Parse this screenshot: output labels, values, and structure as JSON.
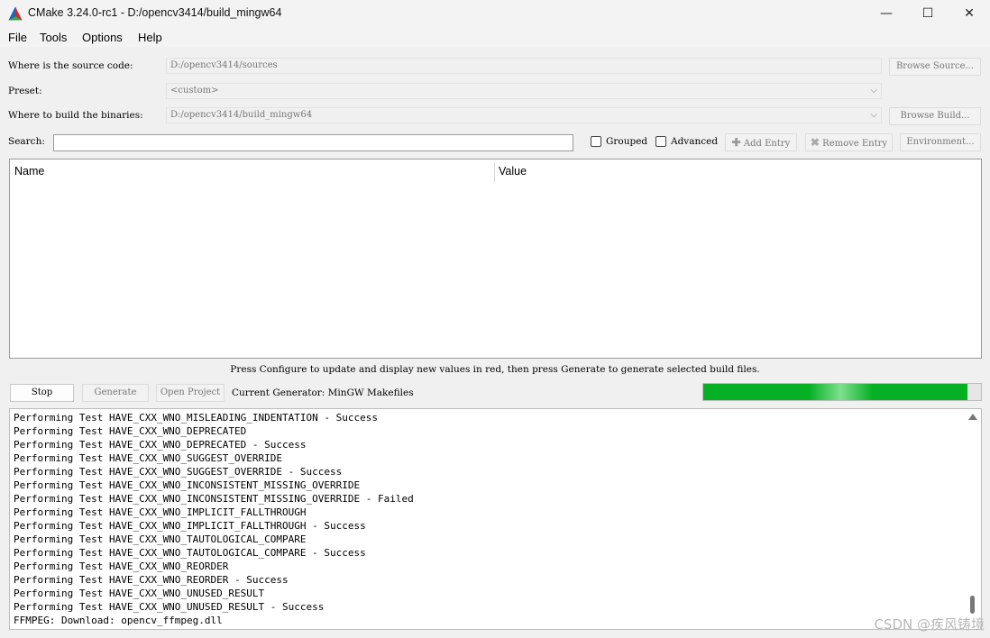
{
  "window": {
    "title": "CMake 3.24.0-rc1 - D:/opencv3414/build_mingw64",
    "controls": {
      "minimize": "—",
      "maximize": "☐",
      "close": "✕"
    }
  },
  "menu": [
    "File",
    "Tools",
    "Options",
    "Help"
  ],
  "form": {
    "source_label": "Where is the source code:",
    "source_value": "D:/opencv3414/sources",
    "browse_source": "Browse Source...",
    "preset_label": "Preset:",
    "preset_value": "<custom>",
    "build_label": "Where to build the binaries:",
    "build_value": "D:/opencv3414/build_mingw64",
    "browse_build": "Browse Build...",
    "search_label": "Search:",
    "search_value": "",
    "grouped_label": "Grouped",
    "grouped_checked": false,
    "advanced_label": "Advanced",
    "advanced_checked": false,
    "add_entry": "Add Entry",
    "remove_entry": "Remove Entry",
    "environment": "Environment..."
  },
  "table": {
    "columns": [
      "Name",
      "Value"
    ],
    "rows": []
  },
  "hint": "Press Configure to update and display new values in red, then press Generate to generate selected build files.",
  "actions": {
    "stop": "Stop",
    "generate": "Generate",
    "open_project": "Open Project",
    "generator_text": "Current Generator: MinGW Makefiles"
  },
  "progress": {
    "value_fraction": 0.95,
    "color": "#06b025"
  },
  "log": [
    "Performing Test HAVE_CXX_WNO_MISLEADING_INDENTATION - Success",
    "Performing Test HAVE_CXX_WNO_DEPRECATED",
    "Performing Test HAVE_CXX_WNO_DEPRECATED - Success",
    "Performing Test HAVE_CXX_WNO_SUGGEST_OVERRIDE",
    "Performing Test HAVE_CXX_WNO_SUGGEST_OVERRIDE - Success",
    "Performing Test HAVE_CXX_WNO_INCONSISTENT_MISSING_OVERRIDE",
    "Performing Test HAVE_CXX_WNO_INCONSISTENT_MISSING_OVERRIDE - Failed",
    "Performing Test HAVE_CXX_WNO_IMPLICIT_FALLTHROUGH",
    "Performing Test HAVE_CXX_WNO_IMPLICIT_FALLTHROUGH - Success",
    "Performing Test HAVE_CXX_WNO_TAUTOLOGICAL_COMPARE",
    "Performing Test HAVE_CXX_WNO_TAUTOLOGICAL_COMPARE - Success",
    "Performing Test HAVE_CXX_WNO_REORDER",
    "Performing Test HAVE_CXX_WNO_REORDER - Success",
    "Performing Test HAVE_CXX_WNO_UNUSED_RESULT",
    "Performing Test HAVE_CXX_WNO_UNUSED_RESULT - Success",
    "FFMPEG: Download: opencv_ffmpeg.dll"
  ],
  "watermark": "CSDN @疾风铸境"
}
